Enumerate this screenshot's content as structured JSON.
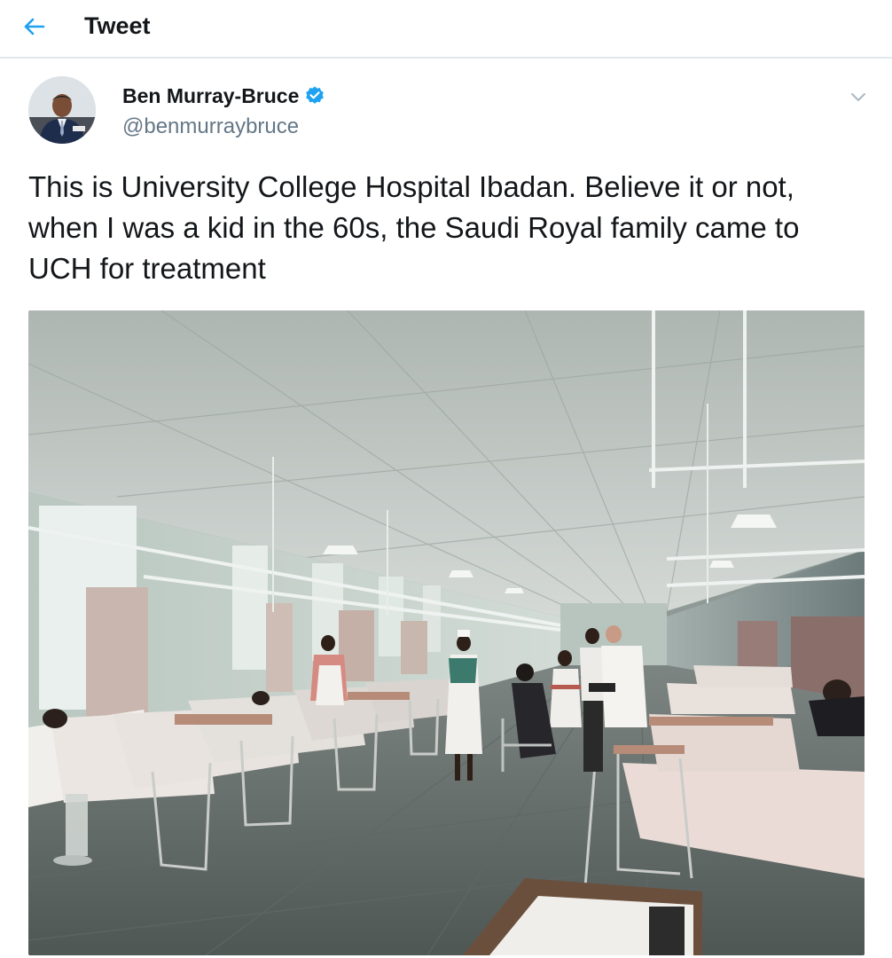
{
  "header": {
    "title": "Tweet",
    "back_icon": "arrow-left-icon",
    "accent_color": "#1da1f2"
  },
  "author": {
    "name": "Ben Murray-Bruce",
    "handle": "@benmurraybruce",
    "verified": true,
    "verified_icon": "verified-badge-icon"
  },
  "tweet": {
    "text": "This is University College Hospital Ibadan. Believe it or not, when I was a kid in the 60s, the Saudi Royal family came to UCH for treatment",
    "menu_icon": "chevron-down-icon"
  }
}
